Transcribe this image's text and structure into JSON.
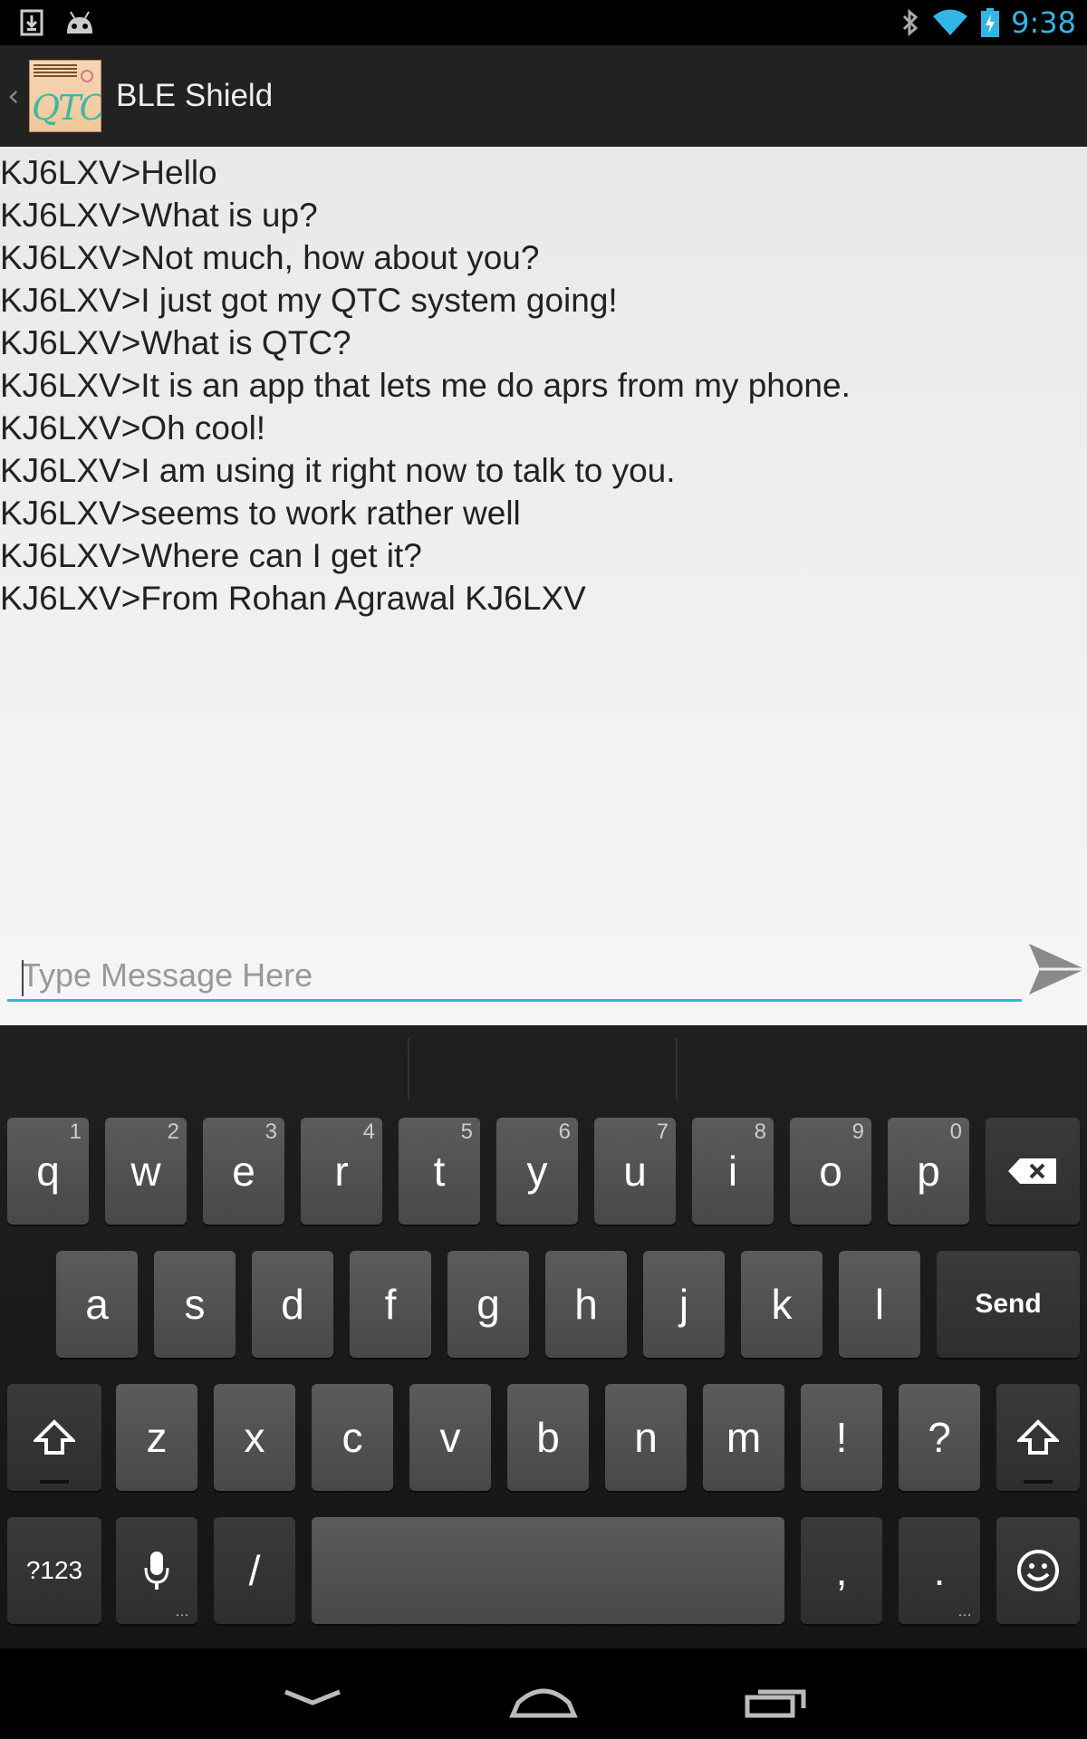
{
  "status_bar": {
    "time": "9:38",
    "icons": [
      "download-icon",
      "android-icon",
      "bluetooth-icon",
      "wifi-icon",
      "battery-charging-icon"
    ]
  },
  "action_bar": {
    "title": "BLE Shield",
    "logo_text": "QTC"
  },
  "messages": [
    "KJ6LXV>Hello",
    "KJ6LXV>What is up?",
    "KJ6LXV>Not much, how about you?",
    "KJ6LXV>I just got my QTC system going!",
    "KJ6LXV>What is QTC?",
    "KJ6LXV>It is an app that lets me do aprs from my phone.",
    "KJ6LXV>Oh cool!",
    "KJ6LXV>I am using it right now to talk to you.",
    "KJ6LXV>seems to work rather well",
    "KJ6LXV>Where can I get it?",
    "KJ6LXV>From Rohan Agrawal KJ6LXV"
  ],
  "compose": {
    "placeholder": "Type Message Here",
    "value": ""
  },
  "keyboard": {
    "row1": [
      {
        "label": "q",
        "hint": "1"
      },
      {
        "label": "w",
        "hint": "2"
      },
      {
        "label": "e",
        "hint": "3"
      },
      {
        "label": "r",
        "hint": "4"
      },
      {
        "label": "t",
        "hint": "5"
      },
      {
        "label": "y",
        "hint": "6"
      },
      {
        "label": "u",
        "hint": "7"
      },
      {
        "label": "i",
        "hint": "8"
      },
      {
        "label": "o",
        "hint": "9"
      },
      {
        "label": "p",
        "hint": "0"
      }
    ],
    "row2": [
      "a",
      "s",
      "d",
      "f",
      "g",
      "h",
      "j",
      "k",
      "l"
    ],
    "send_label": "Send",
    "row3": [
      "z",
      "x",
      "c",
      "v",
      "b",
      "n",
      "m",
      "!",
      "?"
    ],
    "symbols_label": "?123",
    "slash_label": "/",
    "comma_label": ",",
    "period_label": "."
  },
  "colors": {
    "accent": "#33b5e5",
    "action_bar": "#222222",
    "content_bg": "#efefef",
    "key_bg": "#525252"
  }
}
